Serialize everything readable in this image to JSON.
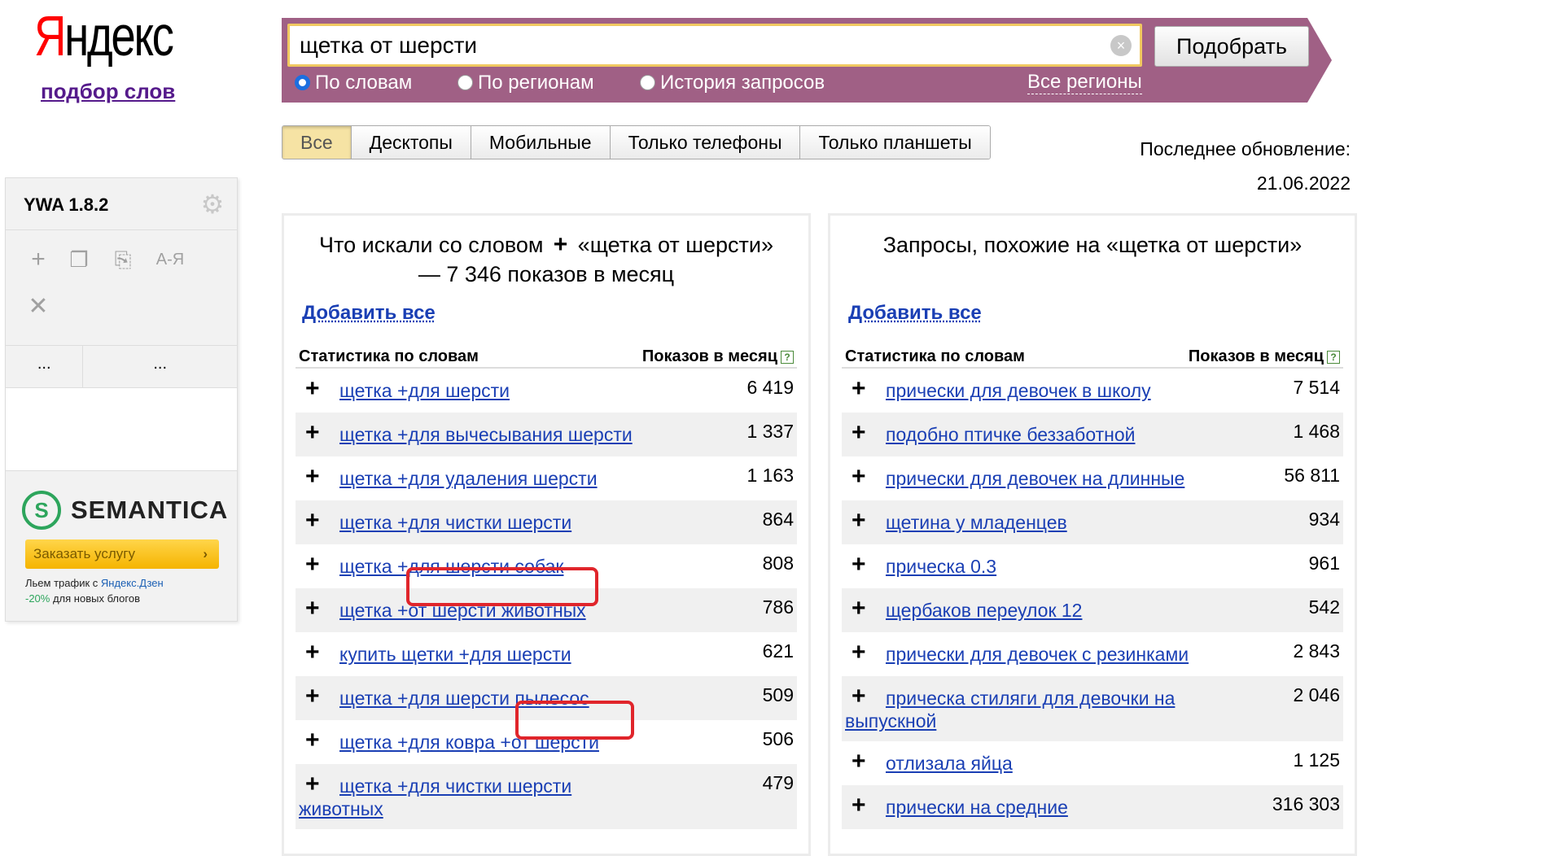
{
  "logo": {
    "first_letter": "Я",
    "rest": "ндекс",
    "subtitle": "подбор слов"
  },
  "search": {
    "value": "щетка от шерсти",
    "submit_label": "Подобрать",
    "radios": [
      "По словам",
      "По регионам",
      "История запросов"
    ],
    "selected_radio": "По словам",
    "regions_link": "Все регионы"
  },
  "tabs": [
    "Все",
    "Десктопы",
    "Мобильные",
    "Только телефоны",
    "Только планшеты"
  ],
  "active_tab": "Все",
  "last_update": {
    "label": "Последнее обновление:",
    "date": "21.06.2022"
  },
  "ywa": {
    "title": "YWA 1.8.2",
    "col1": "...",
    "col2": "...",
    "tool_az": "A-Я",
    "promo": {
      "brand": "SEMANTICA",
      "button": "Заказать услугу",
      "note_pre": "Льем трафик с ",
      "note_link": "Яндекс.Дзен",
      "note_discount": "-20%",
      "note_post": " для новых блогов"
    }
  },
  "left_panel": {
    "title_pre": "Что искали со словом",
    "title_post": "«щетка от шерсти» — 7 346 показов в месяц",
    "add_all": "Добавить все",
    "col_phrase": "Статистика по словам",
    "col_count": "Показов в месяц",
    "rows": [
      {
        "phrase": "щетка +для шерсти",
        "count": "6 419"
      },
      {
        "phrase": "щетка +для вычесывания шерсти",
        "count": "1 337"
      },
      {
        "phrase": "щетка +для удаления шерсти",
        "count": "1 163"
      },
      {
        "phrase": "щетка +для чистки шерсти",
        "count": "864"
      },
      {
        "phrase": "щетка +для шерсти собак",
        "count": "808"
      },
      {
        "phrase": "щетка +от шерсти животных",
        "count": "786"
      },
      {
        "phrase": "купить щетки +для шерсти",
        "count": "621"
      },
      {
        "phrase": "щетка +для шерсти пылесос",
        "count": "509"
      },
      {
        "phrase": "щетка +для ковра +от шерсти",
        "count": "506"
      },
      {
        "phrase": "щетка +для чистки шерсти животных",
        "count": "479"
      }
    ]
  },
  "right_panel": {
    "title": "Запросы, похожие на «щетка от шерсти»",
    "add_all": "Добавить все",
    "col_phrase": "Статистика по словам",
    "col_count": "Показов в месяц",
    "rows": [
      {
        "phrase": "прически для девочек в школу",
        "count": "7 514"
      },
      {
        "phrase": "подобно птичке беззаботной",
        "count": "1 468"
      },
      {
        "phrase": "прически для девочек на длинные",
        "count": "56 811"
      },
      {
        "phrase": "щетина у младенцев",
        "count": "934"
      },
      {
        "phrase": "прическа 0.3",
        "count": "961"
      },
      {
        "phrase": "щербаков переулок 12",
        "count": "542"
      },
      {
        "phrase": "прически для девочек с резинками",
        "count": "2 843"
      },
      {
        "phrase": "прическа стиляги для девочки на выпускной",
        "count": "2 046"
      },
      {
        "phrase": "отлизала яйца",
        "count": "1 125"
      },
      {
        "phrase": "прически на средние",
        "count": "316 303"
      }
    ]
  },
  "colors": {
    "search_band": "#a06085",
    "link": "#1a3fb4",
    "highlight": "#e0252b",
    "brand_red": "#ff0000"
  }
}
